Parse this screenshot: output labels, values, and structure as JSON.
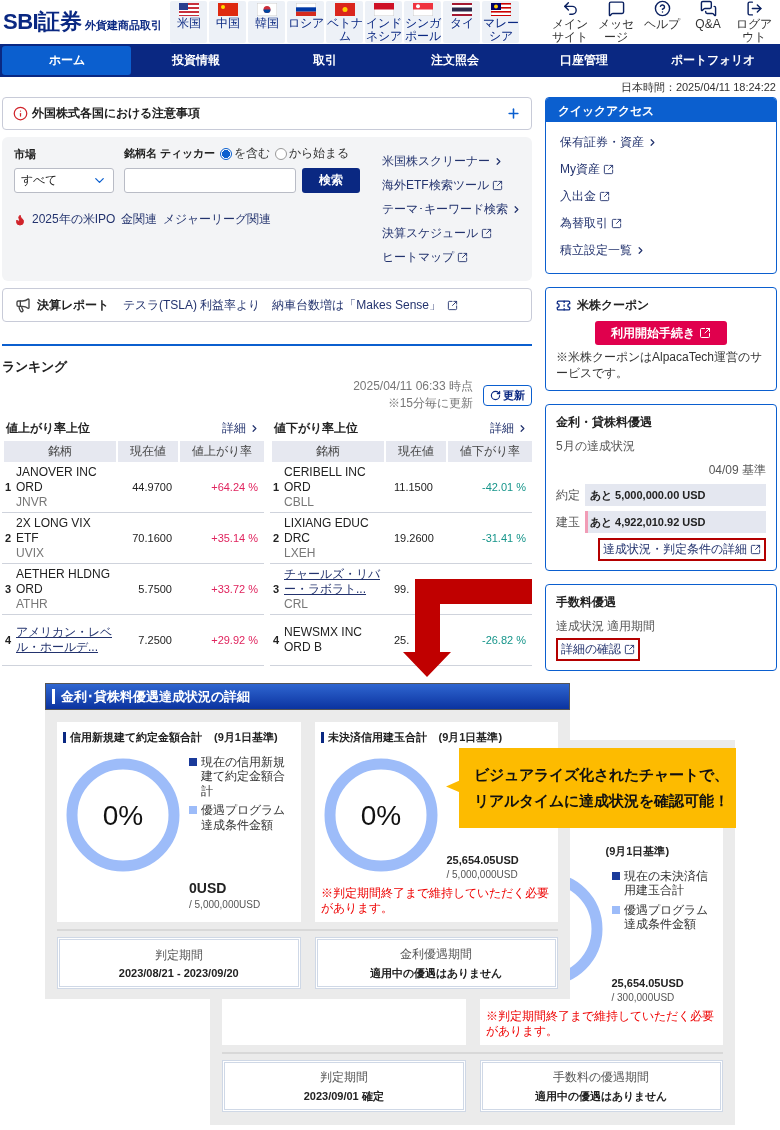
{
  "header": {
    "logo": "SBI証券",
    "subtitle": "外貨建商品取引",
    "flags": [
      {
        "label": "米国",
        "kind": "us"
      },
      {
        "label": "中国",
        "kind": "cn"
      },
      {
        "label": "韓国",
        "kind": "kr"
      },
      {
        "label": "ロシア",
        "kind": "ru"
      },
      {
        "label": "ベトナム",
        "kind": "vn"
      },
      {
        "label": "インドネシア",
        "kind": "id"
      },
      {
        "label": "シンガポール",
        "kind": "sg"
      },
      {
        "label": "タイ",
        "kind": "th"
      },
      {
        "label": "マレーシア",
        "kind": "my"
      }
    ],
    "tools": [
      {
        "label": "メインサイト",
        "kind": "main"
      },
      {
        "label": "メッセージ",
        "kind": "message"
      },
      {
        "label": "ヘルプ",
        "kind": "help"
      },
      {
        "label": "Q&A",
        "kind": "qa"
      },
      {
        "label": "ログアウト",
        "kind": "logout"
      }
    ]
  },
  "nav": [
    {
      "label": "ホーム",
      "selected": true
    },
    {
      "label": "投資情報",
      "selected": false
    },
    {
      "label": "取引",
      "selected": false
    },
    {
      "label": "注文照会",
      "selected": false
    },
    {
      "label": "口座管理",
      "selected": false
    },
    {
      "label": "ポートフォリオ",
      "selected": false
    }
  ],
  "clock": "日本時間：2025/04/11 18:24:22",
  "notice": {
    "title": "外国株式各国における注意事項"
  },
  "search": {
    "market_label": "市場",
    "market_value": "すべて",
    "name_label": "銘柄名 ティッカー",
    "match_options": [
      {
        "label": "を含む",
        "selected": true
      },
      {
        "label": "から始まる",
        "selected": false
      }
    ],
    "button": "検索",
    "tags": [
      "2025年の米IPO",
      "金関連",
      "メジャーリーグ関連"
    ],
    "links": [
      {
        "label": "米国株スクリーナー",
        "kind": "chevron"
      },
      {
        "label": "海外ETF検索ツール",
        "kind": "external"
      },
      {
        "label": "テーマ･キーワード検索",
        "kind": "chevron"
      },
      {
        "label": "決算スケジュール",
        "kind": "external"
      },
      {
        "label": "ヒートマップ",
        "kind": "external"
      }
    ]
  },
  "report": {
    "title": "決算レポート",
    "link": "テスラ(TSLA) 利益率より　納車台数増は「Makes Sense」"
  },
  "ranking": {
    "title": "ランキング",
    "updated": "2025/04/11 06:33 時点",
    "interval": "※15分毎に更新",
    "refresh": "更新",
    "tables": [
      {
        "title": "値上がり率上位",
        "kind": "up",
        "more": "詳細",
        "columns": [
          "銘柄",
          "現在値",
          "値上がり率"
        ],
        "rows": [
          {
            "rank": "1",
            "name_lines": [
              "JANOVER INC",
              "ORD"
            ],
            "link": false,
            "ticker": "JNVR",
            "price": "44.9700",
            "change": "+64.24 %"
          },
          {
            "rank": "2",
            "name_lines": [
              "2X LONG VIX",
              "ETF"
            ],
            "link": false,
            "ticker": "UVIX",
            "price": "70.1600",
            "change": "+35.14 %"
          },
          {
            "rank": "3",
            "name_lines": [
              "AETHER HLDNG",
              "ORD"
            ],
            "link": false,
            "ticker": "ATHR",
            "price": "5.7500",
            "change": "+33.72 %"
          },
          {
            "rank": "4",
            "name_lines": [
              "アメリカン・レベ",
              "ル・ホールデ..."
            ],
            "link": true,
            "price": "7.2500",
            "change": "+29.92 %"
          }
        ]
      },
      {
        "title": "値下がり率上位",
        "kind": "down",
        "more": "詳細",
        "columns": [
          "銘柄",
          "現在値",
          "値下がり率"
        ],
        "rows": [
          {
            "rank": "1",
            "name_lines": [
              "CERIBELL INC",
              "ORD"
            ],
            "link": false,
            "ticker": "CBLL",
            "price": "11.1500",
            "change": "-42.01 %"
          },
          {
            "rank": "2",
            "name_lines": [
              "LIXIANG EDUC",
              "DRC"
            ],
            "link": false,
            "ticker": "LXEH",
            "price": "19.2600",
            "change": "-31.41 %"
          },
          {
            "rank": "3",
            "name_lines": [
              "チャールズ・リバ",
              "ー・ラボラト..."
            ],
            "link": true,
            "ticker": "CRL",
            "price": "99.",
            "change": ""
          },
          {
            "rank": "4",
            "name_lines": [
              "NEWSMX INC",
              "ORD B"
            ],
            "link": false,
            "price": "25.",
            "change": "-26.82 %"
          }
        ]
      }
    ]
  },
  "quick_access": {
    "title": "クイックアクセス",
    "links": [
      {
        "label": "保有証券・資産",
        "kind": "chevron"
      },
      {
        "label": "My資産",
        "kind": "external"
      },
      {
        "label": "入出金",
        "kind": "external"
      },
      {
        "label": "為替取引",
        "kind": "external"
      },
      {
        "label": "積立設定一覧",
        "kind": "chevron"
      }
    ]
  },
  "coupon": {
    "title": "米株クーポン",
    "button": "利用開始手続き",
    "note": "※米株クーポンはAlpacaTech運営のサービスです。"
  },
  "rate_card": {
    "title": "金利・貸株料優遇",
    "subtitle": "5月の達成状況",
    "basis": "04/09 基準",
    "bars": [
      {
        "label": "約定",
        "text": "あと 5,000,000.00 USD"
      },
      {
        "label": "建玉",
        "text": "あと 4,922,010.92 USD",
        "level": 0.016
      }
    ],
    "link": "達成状況・判定条件の詳細"
  },
  "fee_card": {
    "title": "手数料優遇",
    "subtitle": "達成状況 適用期間",
    "link": "詳細の確認"
  },
  "callout": {
    "lines": [
      "ビジュアライズ化されたチャートで、",
      "リアルタイムに達成状況を確認可能！"
    ]
  },
  "front_panel": {
    "title": "金利･貸株料優遇達成状況の詳細",
    "cards": [
      {
        "title": "信用新規建て約定金額合計",
        "basis": "(9月1日基準)",
        "percent": "0%",
        "legend": [
          "現在の信用新規建て約定金額合計",
          "優遇プログラム達成条件金額"
        ],
        "value": "0USD",
        "target": "/ 5,000,000USD"
      },
      {
        "title": "未決済信用建玉合計",
        "basis": "(9月1日基準)",
        "percent": "0%",
        "value": "25,654.05USD",
        "target": "/ 5,000,000USD",
        "note": "※判定期間終了まで維持していただく必要があります。"
      }
    ],
    "boxes": [
      {
        "label": "判定期間",
        "value": "2023/08/21 - 2023/09/20"
      },
      {
        "label": "金利優遇期間",
        "value": "適用中の優遇はありません"
      }
    ]
  },
  "back_panel": {
    "card": {
      "basis": "(9月1日基準)",
      "legend": [
        "現在の未決済信用建玉合計",
        "優遇プログラム達成条件金額"
      ],
      "value": "25,654.05USD",
      "target": "/ 300,000USD",
      "note": "※判定期間終了まで維持していただく必要があります。"
    },
    "boxes": [
      {
        "label": "判定期間",
        "value": "2023/09/01 確定"
      },
      {
        "label": "手数料の優遇期間",
        "value": "適用中の優遇はありません"
      }
    ]
  }
}
